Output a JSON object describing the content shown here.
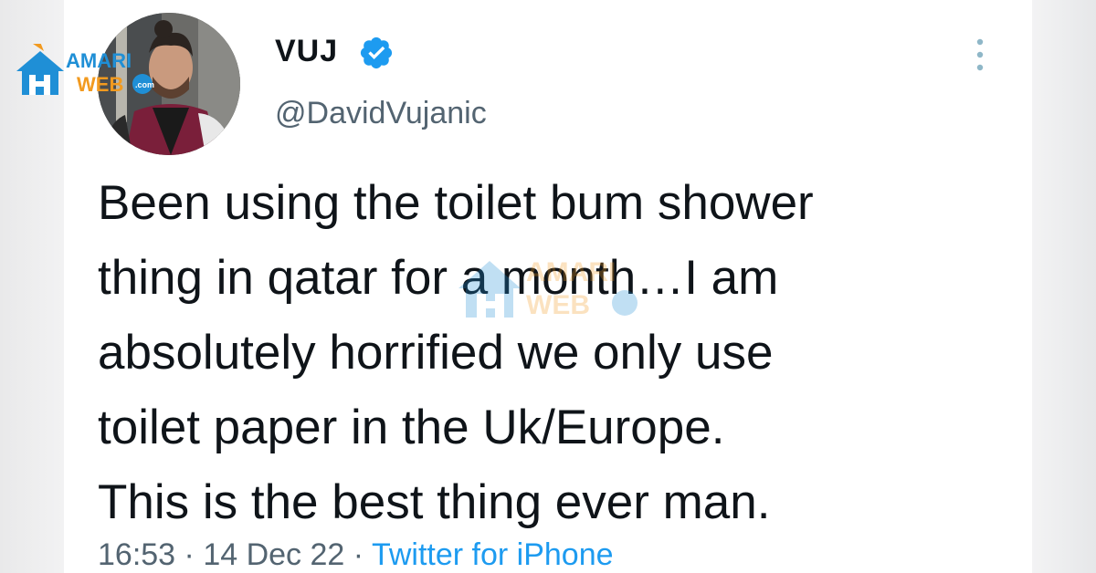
{
  "tweet": {
    "display_name": "VUJ",
    "handle": "@DavidVujanic",
    "text": "Been using the toilet bum shower\nthing in qatar for a month…I am\nabsolutely horrified we only use\ntoilet paper in the Uk/Europe.\nThis is the best thing ever man.",
    "time": "16:53",
    "separator": "·",
    "date": "14 Dec 22",
    "source": "Twitter for iPhone"
  },
  "logo": {
    "line1": "AMARI",
    "line2": "WEB",
    "domain": ".com"
  },
  "colors": {
    "text": "#0f1419",
    "secondary": "#536471",
    "twitter_blue": "#1d9bf0",
    "logo_blue": "#1f8fd6",
    "logo_orange": "#f29a1f"
  },
  "icons": {
    "verified": "verified-badge-icon",
    "more": "vertical-ellipsis-icon"
  }
}
